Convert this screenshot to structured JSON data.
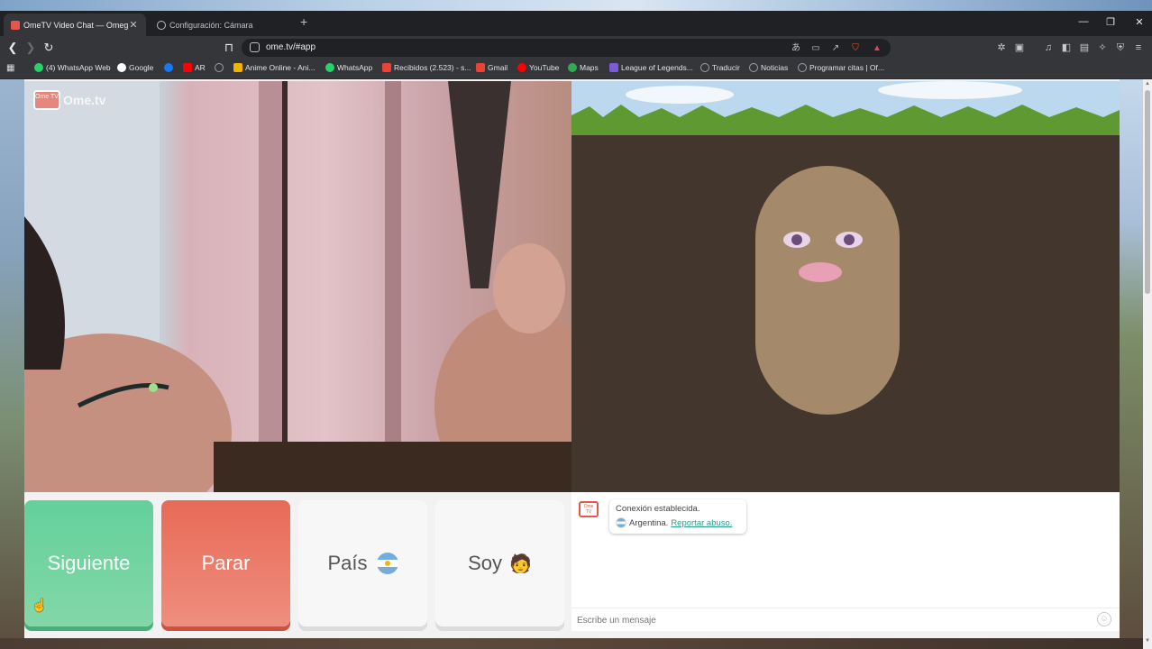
{
  "browser": {
    "tabs": [
      {
        "title": "OmeTV Video Chat — Omeg",
        "active": true
      },
      {
        "title": "Configuración: Cámara",
        "active": false
      }
    ],
    "url": "ome.tv/#app",
    "bookmarks": [
      {
        "label": "(4) WhatsApp Web",
        "icon": "whatsapp-icon",
        "color": "#25d366"
      },
      {
        "label": "Google",
        "icon": "google-icon",
        "color": "#ffffff"
      },
      {
        "label": "",
        "icon": "facebook-icon",
        "color": "#1877f2"
      },
      {
        "label": "AR",
        "icon": "youtube-icon",
        "color": "#ff0000"
      },
      {
        "label": "",
        "icon": "globe-icon",
        "color": "#9aa0a6"
      },
      {
        "label": "Anime Online - Ani...",
        "icon": "anime-icon",
        "color": "#f0b400"
      },
      {
        "label": "WhatsApp",
        "icon": "whatsapp-icon",
        "color": "#25d366"
      },
      {
        "label": "Recibidos (2.523) - s...",
        "icon": "gmail-icon",
        "color": "#ea4335"
      },
      {
        "label": "Gmail",
        "icon": "gmail-icon",
        "color": "#ea4335"
      },
      {
        "label": "YouTube",
        "icon": "youtube-icon",
        "color": "#ff0000"
      },
      {
        "label": "Maps",
        "icon": "maps-icon",
        "color": "#34a853"
      },
      {
        "label": "League of Legends...",
        "icon": "lol-icon",
        "color": "#7b5cd6"
      },
      {
        "label": "Traducir",
        "icon": "globe-icon",
        "color": "#9aa0a6"
      },
      {
        "label": "Noticias",
        "icon": "globe-icon",
        "color": "#9aa0a6"
      },
      {
        "label": "Programar citas | Of...",
        "icon": "globe-icon",
        "color": "#9aa0a6"
      }
    ]
  },
  "app": {
    "logo_box": "Ome TV",
    "logo_text": "Ome.tv",
    "buttons": {
      "next": "Siguiente",
      "stop": "Parar",
      "country": "País",
      "gender": "Soy",
      "gender_emoji": "🧑"
    },
    "chat": {
      "logo": "Ome TV",
      "status": "Conexión establecida.",
      "country": "Argentina.",
      "report": "Reportar abuso.",
      "placeholder": "Escribe un mensaje"
    }
  },
  "colors": {
    "next": "#63d09b",
    "stop": "#e86a57",
    "link": "#2b9a8a"
  }
}
